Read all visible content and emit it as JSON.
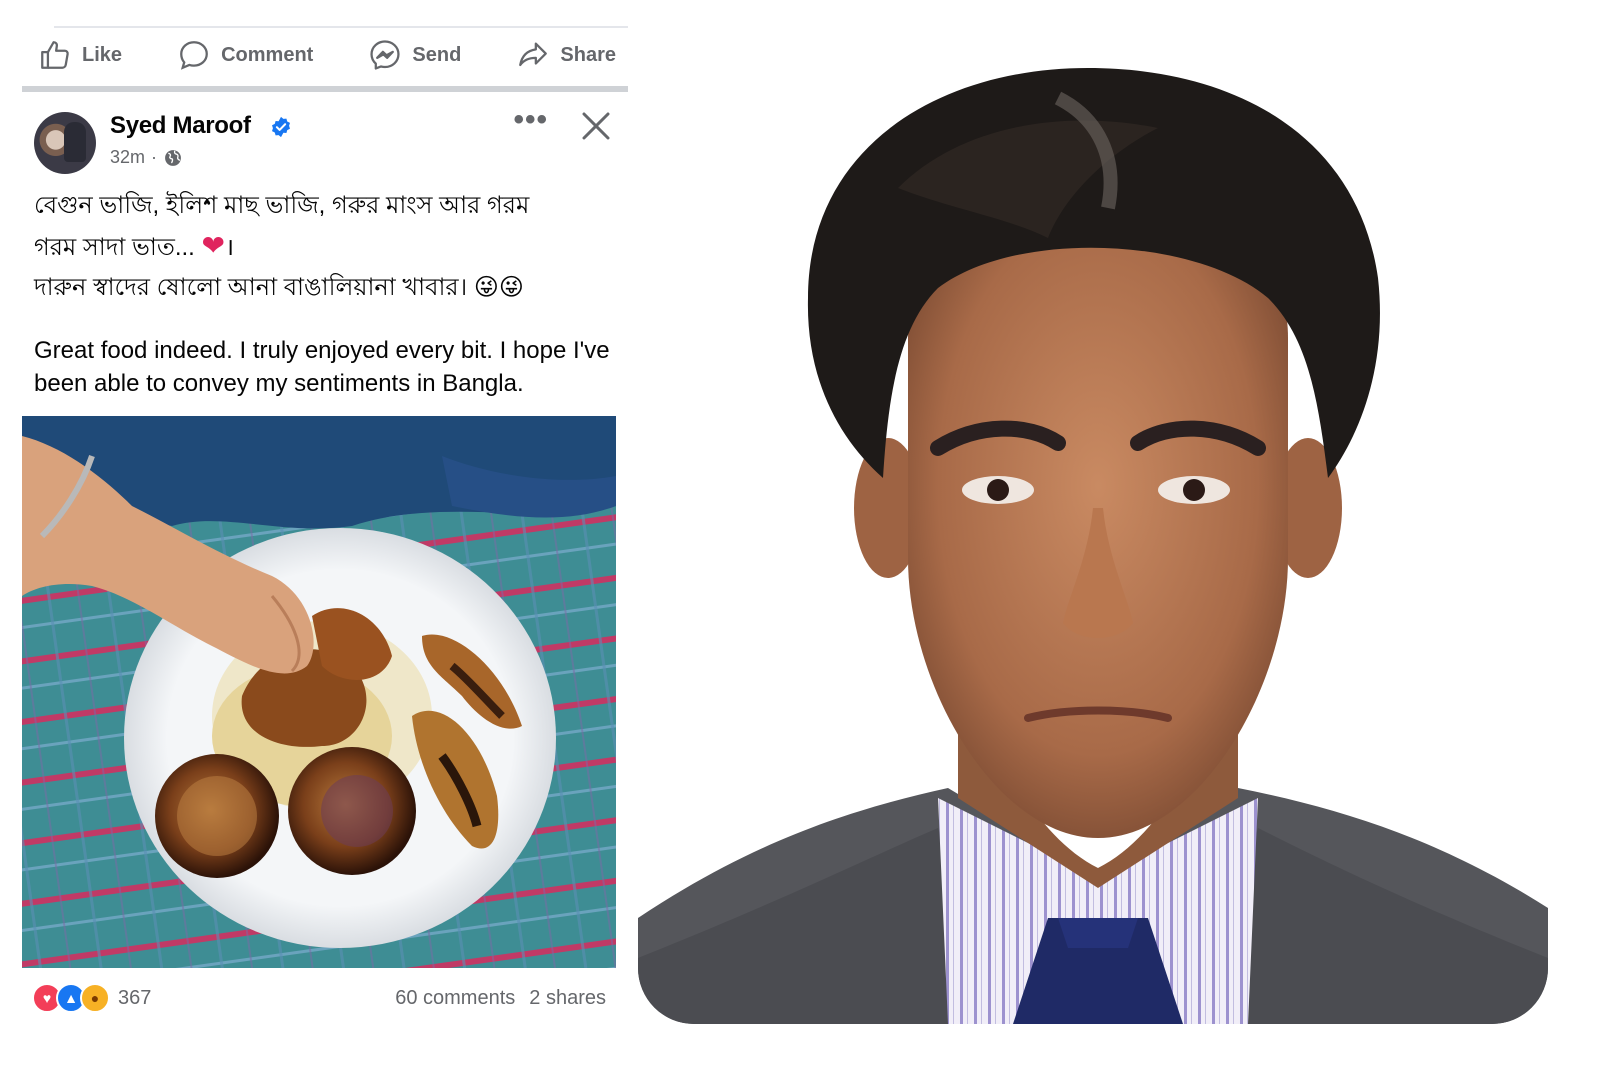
{
  "actions": {
    "like": "Like",
    "comment": "Comment",
    "send": "Send",
    "share": "Share"
  },
  "post": {
    "author": "Syed Maroof",
    "time": "32m",
    "separator": "·",
    "more": "•••",
    "line1": "বেগুন ভাজি, ইলিশ মাছ ভাজি, গরুর মাংস আর গরম",
    "line2": "গরম সাদা ভাত...",
    "line2_end": "।",
    "line3": "দারুন স্বাদের  ষোলো আনা বাঙালিয়ানা খাবার।",
    "line3_emoji": "😜😜",
    "english": "Great food indeed. I truly enjoyed every bit. I hope I've been able to convey my sentiments in Bangla.",
    "heart_emoji": "❤"
  },
  "stats": {
    "reactions": "367",
    "comments": "60 comments",
    "shares": "2 shares"
  },
  "colors": {
    "facebook_blue": "#1877f2",
    "secondary_text": "#65676b",
    "divider": "#cfd2d6"
  }
}
